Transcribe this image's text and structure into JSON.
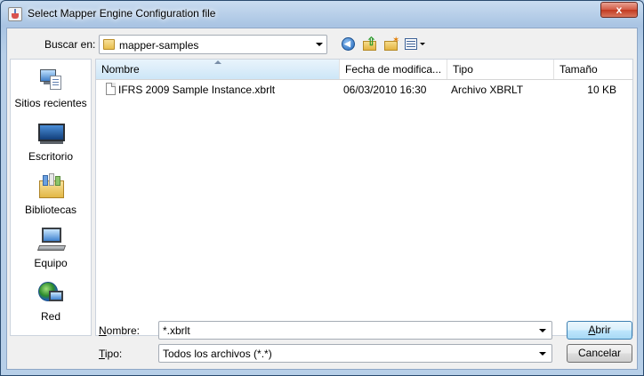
{
  "window": {
    "title": "Select Mapper Engine Configuration file",
    "close_glyph": "x"
  },
  "lookin": {
    "label": "Buscar en:",
    "value": "mapper-samples"
  },
  "toolbar": {
    "icons": [
      "back-icon",
      "up-folder-icon",
      "new-folder-icon",
      "view-menu-icon"
    ]
  },
  "places": [
    {
      "label": "Sitios recientes",
      "icon": "recent-places-icon"
    },
    {
      "label": "Escritorio",
      "icon": "desktop-icon"
    },
    {
      "label": "Bibliotecas",
      "icon": "libraries-icon"
    },
    {
      "label": "Equipo",
      "icon": "computer-icon"
    },
    {
      "label": "Red",
      "icon": "network-icon"
    }
  ],
  "columns": {
    "name": "Nombre",
    "date": "Fecha de modifica...",
    "type": "Tipo",
    "size": "Tamaño"
  },
  "files": [
    {
      "name": "IFRS 2009 Sample Instance.xbrlt",
      "date": "06/03/2010 16:30",
      "type": "Archivo XBRLT",
      "size": "10 KB"
    }
  ],
  "bottom": {
    "name_label_underlined": "N",
    "name_label_rest": "ombre:",
    "name_value": "*.xbrlt",
    "type_label_underlined": "T",
    "type_label_rest": "ipo:",
    "type_value": "Todos los archivos (*.*)",
    "open_underlined": "A",
    "open_rest": "brir",
    "cancel_label": "Cancelar"
  },
  "colors": {
    "title_bar": "#a9c4e3",
    "close_button": "#c1391f",
    "client_bg": "#f0f0f0",
    "sorted_header": "#cde6f7"
  }
}
